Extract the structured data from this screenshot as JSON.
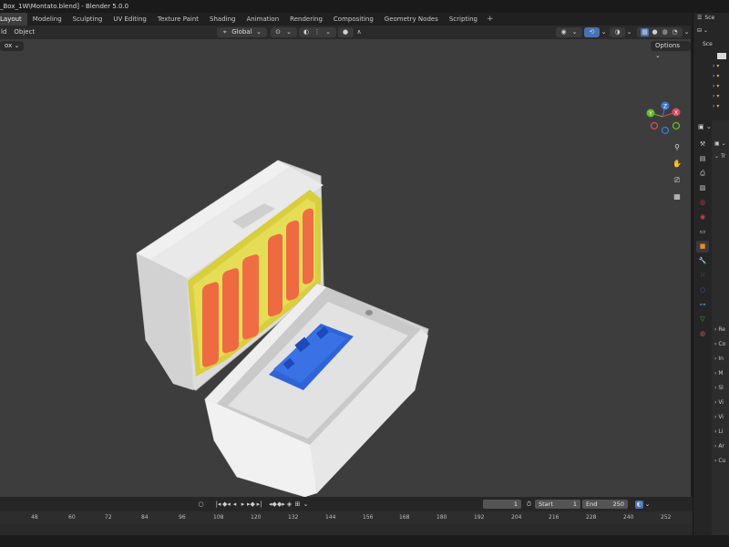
{
  "window": {
    "title": "_Box_1W\\Montato.blend] - Blender 5.0.0"
  },
  "workspaces": {
    "tabs": [
      {
        "label": "Layout",
        "active": true
      },
      {
        "label": "Modeling"
      },
      {
        "label": "Sculpting"
      },
      {
        "label": "UV Editing"
      },
      {
        "label": "Texture Paint"
      },
      {
        "label": "Shading"
      },
      {
        "label": "Animation"
      },
      {
        "label": "Rendering"
      },
      {
        "label": "Compositing"
      },
      {
        "label": "Geometry Nodes"
      },
      {
        "label": "Scripting"
      }
    ],
    "add": "+"
  },
  "viewport_header": {
    "menu_add": "ld",
    "menu_object": "Object",
    "orientation": "Global",
    "sub_mode": "ox",
    "options": "Options"
  },
  "gizmo": {
    "y": "Y",
    "z": "Z",
    "x": "X"
  },
  "timeline": {
    "current_frame": "1",
    "start_label": "Start",
    "start": "1",
    "end_label": "End",
    "end": "250",
    "ruler": [
      "48",
      "60",
      "72",
      "84",
      "96",
      "108",
      "120",
      "132",
      "144",
      "156",
      "168",
      "180",
      "192",
      "204",
      "216",
      "228",
      "240",
      "252"
    ]
  },
  "outliner": {
    "scene_label": "Sce",
    "scene_label_2": "Sce"
  },
  "properties": {
    "header_text": "Tr",
    "sections": [
      "Re",
      "Co",
      "In",
      "M",
      "Sl",
      "Vi",
      "Vi",
      "Li",
      "Ar",
      "Cu"
    ]
  },
  "colors": {
    "viewport_bg": "#3d3d3d",
    "box_white": "#e6e6e6",
    "battery_yellow": "#e1d84c",
    "battery_orange": "#ee6a40",
    "pcb_blue": "#2f64d8",
    "accent_blue": "#4772b3"
  }
}
